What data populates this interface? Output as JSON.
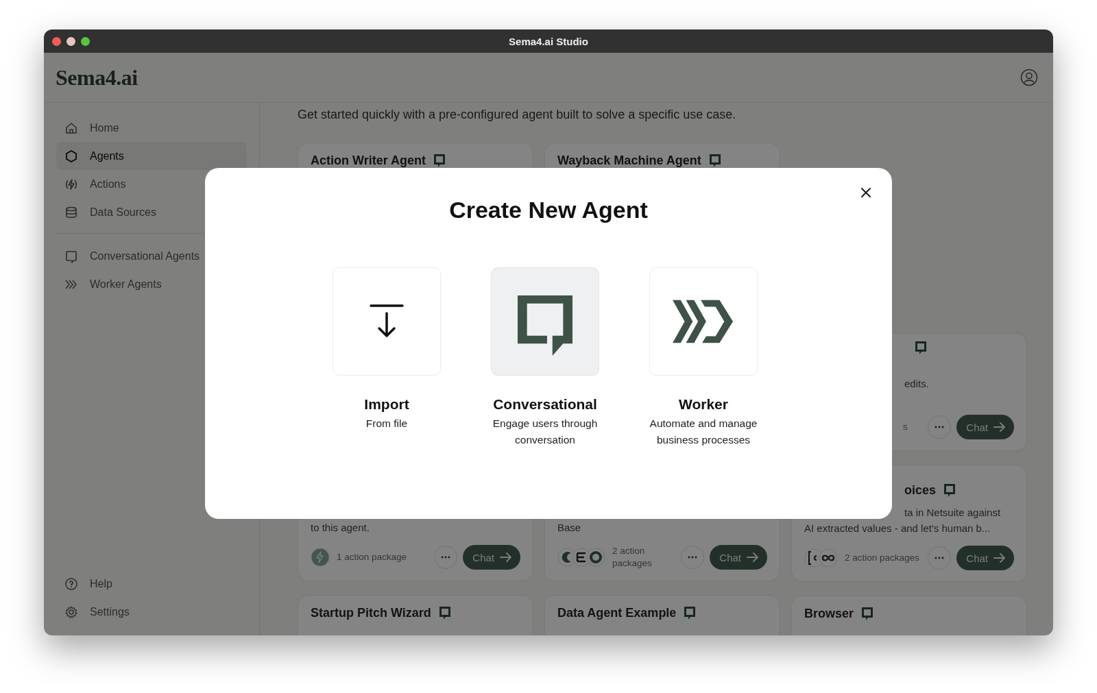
{
  "window": {
    "title": "Sema4.ai Studio"
  },
  "header": {
    "logo": "Sema4.ai"
  },
  "sidebar": {
    "items": [
      {
        "kind": "home",
        "label": "Home",
        "selected": false
      },
      {
        "kind": "hexagon",
        "label": "Agents",
        "selected": true
      },
      {
        "kind": "bolt",
        "label": "Actions",
        "selected": false
      },
      {
        "kind": "database",
        "label": "Data Sources",
        "selected": false
      }
    ],
    "agent_types": [
      {
        "kind": "chat",
        "label": "Conversational Agents",
        "selected": false
      },
      {
        "kind": "chevrons",
        "label": "Worker Agents",
        "selected": false
      }
    ],
    "bottom_items": [
      {
        "kind": "help",
        "label": "Help",
        "selected": false
      },
      {
        "kind": "gear",
        "label": "Settings",
        "selected": false
      }
    ]
  },
  "main": {
    "subtitle": "Get started quickly with a pre-configured agent built to solve a specific use case.",
    "card_columns": [
      {
        "cards": [
          {
            "title": "Action Writer Agent"
          },
          {
            "description": [
              "to this agent."
            ],
            "packages": "1 action package",
            "chat": "Chat"
          },
          {
            "title": "Startup Pitch Wizard"
          }
        ]
      },
      {
        "cards": [
          {
            "title": "Wayback Machine Agent"
          },
          {
            "description": [
              "Base"
            ],
            "packages": "2 action\npackages",
            "chat": "Chat"
          },
          {
            "title": "Data Agent Example"
          }
        ]
      },
      {
        "cards": [
          {
            "description": [
              "edits."
            ],
            "packages": "s",
            "chat": "Chat"
          },
          {
            "title": "oices",
            "description": [
              "ta in Netsuite against",
              "AI extracted values - and let's human b..."
            ],
            "packages": "2 action packages",
            "chat": "Chat"
          },
          {
            "title": "Browser"
          }
        ]
      }
    ]
  },
  "modal": {
    "title": "Create New Agent",
    "options": [
      {
        "kind": "import",
        "title": "Import",
        "description": "From file",
        "selected": false
      },
      {
        "kind": "conversational",
        "title": "Conversational",
        "description": "Engage users through conversation",
        "selected": true
      },
      {
        "kind": "worker",
        "title": "Worker",
        "description": "Automate and manage business processes",
        "selected": false
      }
    ]
  }
}
